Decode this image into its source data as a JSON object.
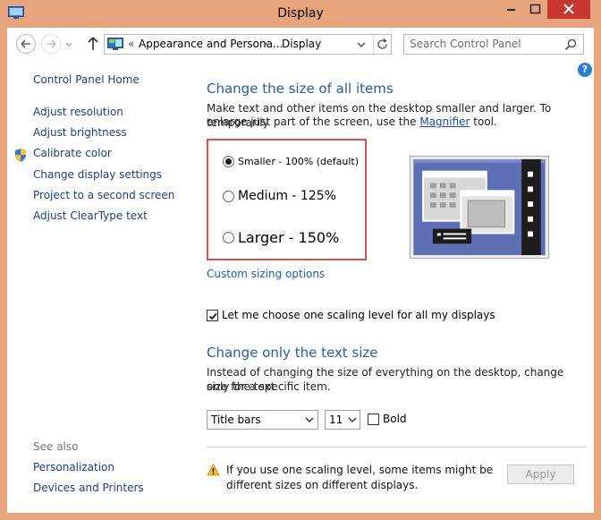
{
  "window": {
    "title": "Display",
    "colors": {
      "frame": "#e8a47c",
      "close": "#c7372f",
      "link": "#1f3f7a",
      "heading": "#2a5c9e",
      "highlight_box": "#d8524f"
    }
  },
  "address_bar": {
    "prefix": "«",
    "crumb1": "Appearance and Persona...",
    "separator": "›",
    "crumb2": "Display",
    "icons": [
      "back-arrow-icon",
      "forward-arrow-icon",
      "up-arrow-icon",
      "control-panel-icon",
      "chevron-down-icon",
      "refresh-icon"
    ]
  },
  "search": {
    "placeholder": "Search Control Panel",
    "icon": "search-icon"
  },
  "help_label": "?",
  "sidebar": {
    "items": [
      {
        "label": "Control Panel Home"
      },
      {
        "label": "Adjust resolution"
      },
      {
        "label": "Adjust brightness"
      },
      {
        "label": "Calibrate color",
        "icon": "shield-icon"
      },
      {
        "label": "Change display settings"
      },
      {
        "label": "Project to a second screen"
      },
      {
        "label": "Adjust ClearType text"
      }
    ],
    "see_also": {
      "title": "See also",
      "items": [
        {
          "label": "Personalization"
        },
        {
          "label": "Devices and Printers"
        }
      ]
    }
  },
  "main": {
    "heading": "Change the size of all items",
    "description_1": "Make text and other items on the desktop smaller and larger. To temporarily",
    "description_2a": "enlarge just part of the screen, use the ",
    "magnifier_link": "Magnifier",
    "description_2b": " tool.",
    "options": [
      {
        "label": "Smaller - 100% (default)",
        "selected": true
      },
      {
        "label": "Medium - 125%",
        "selected": false
      },
      {
        "label": "Larger - 150%",
        "selected": false
      }
    ],
    "custom_link": "Custom sizing options",
    "scaling_checkbox": {
      "label": "Let me choose one scaling level for all my displays",
      "checked": true
    },
    "text_heading": "Change only the text size",
    "text_description_1": "Instead of changing the size of everything on the desktop, change only the text",
    "text_description_2": "size for a specific item.",
    "item_select": {
      "value": "Title bars"
    },
    "size_select": {
      "value": "11"
    },
    "bold_checkbox": {
      "label": "Bold",
      "checked": false
    },
    "warning": {
      "icon": "warning-icon",
      "text": "If you use one scaling level, some items might be different sizes on different displays."
    },
    "apply_label": "Apply"
  }
}
